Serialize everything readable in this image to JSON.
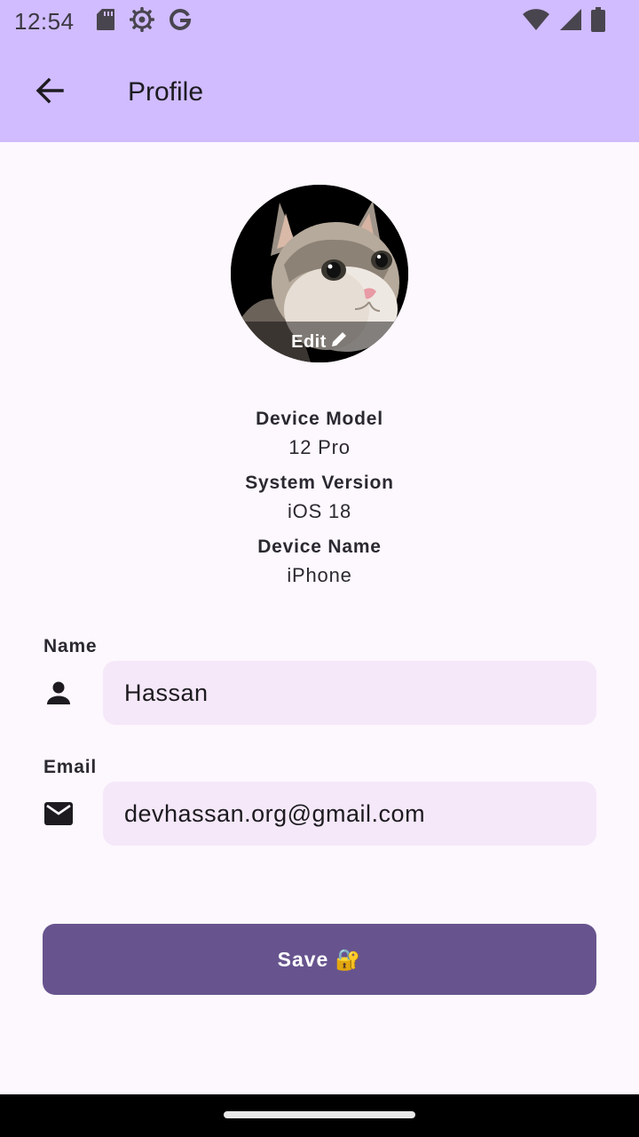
{
  "status_bar": {
    "time": "12:54",
    "left_icons": [
      "sd-card-icon",
      "settings-gear-icon",
      "google-icon"
    ],
    "right_icons": [
      "wifi-icon",
      "cell-signal-icon",
      "battery-icon"
    ]
  },
  "app_bar": {
    "title": "Profile",
    "back_icon": "arrow-back-icon"
  },
  "avatar": {
    "edit_label": "Edit",
    "edit_icon": "pencil-icon"
  },
  "device_info": [
    {
      "label": "Device Model",
      "value": "12 Pro"
    },
    {
      "label": "System Version",
      "value": "iOS 18"
    },
    {
      "label": "Device Name",
      "value": "iPhone"
    }
  ],
  "form": {
    "name": {
      "label": "Name",
      "value": "Hassan",
      "icon": "person-icon"
    },
    "email": {
      "label": "Email",
      "value": "devhassan.org@gmail.com",
      "icon": "mail-icon"
    }
  },
  "save_button": {
    "label": "Save 🔐"
  },
  "colors": {
    "app_bar": "#d0bcfe",
    "background": "#fdf7fe",
    "input_fill": "#f4e8f9",
    "primary_button": "#67548e"
  }
}
